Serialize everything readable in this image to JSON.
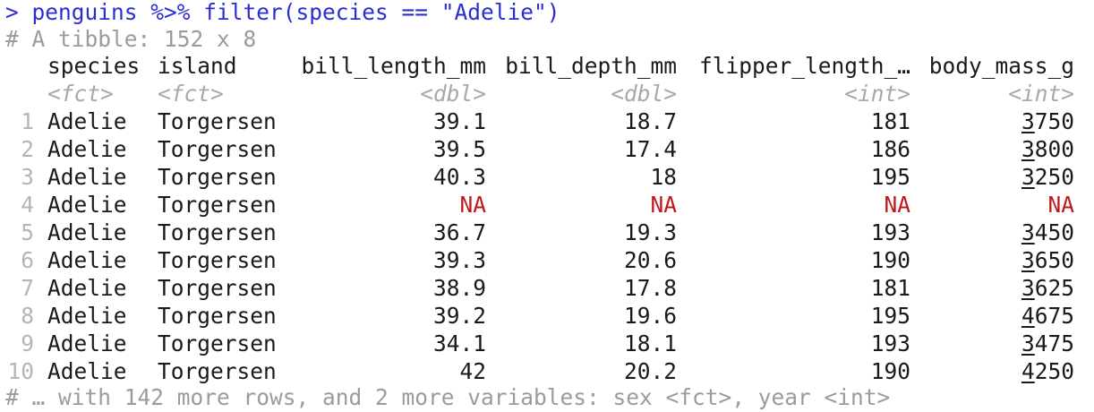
{
  "console": {
    "command": "> penguins %>% filter(species == \"Adelie\")",
    "tibble_info": "# A tibble: 152 x 8",
    "footer": "# … with 142 more rows, and 2 more variables: sex <fct>, year <int>"
  },
  "table": {
    "columns": [
      {
        "name": "species",
        "type": "<fct>"
      },
      {
        "name": "island",
        "type": "<fct>"
      },
      {
        "name": "bill_length_mm",
        "type": "<dbl>"
      },
      {
        "name": "bill_depth_mm",
        "type": "<dbl>"
      },
      {
        "name": "flipper_length_…",
        "type": "<int>"
      },
      {
        "name": "body_mass_g",
        "type": "<int>"
      }
    ],
    "rows": [
      {
        "n": "1",
        "species": "Adelie",
        "island": "Torgersen",
        "bill_length_mm": "39.1",
        "bill_depth_mm": "18.7",
        "flipper_length": "181",
        "body_mass_g": "3750"
      },
      {
        "n": "2",
        "species": "Adelie",
        "island": "Torgersen",
        "bill_length_mm": "39.5",
        "bill_depth_mm": "17.4",
        "flipper_length": "186",
        "body_mass_g": "3800"
      },
      {
        "n": "3",
        "species": "Adelie",
        "island": "Torgersen",
        "bill_length_mm": "40.3",
        "bill_depth_mm": "18",
        "flipper_length": "195",
        "body_mass_g": "3250"
      },
      {
        "n": "4",
        "species": "Adelie",
        "island": "Torgersen",
        "bill_length_mm": "NA",
        "bill_depth_mm": "NA",
        "flipper_length": "NA",
        "body_mass_g": "NA"
      },
      {
        "n": "5",
        "species": "Adelie",
        "island": "Torgersen",
        "bill_length_mm": "36.7",
        "bill_depth_mm": "19.3",
        "flipper_length": "193",
        "body_mass_g": "3450"
      },
      {
        "n": "6",
        "species": "Adelie",
        "island": "Torgersen",
        "bill_length_mm": "39.3",
        "bill_depth_mm": "20.6",
        "flipper_length": "190",
        "body_mass_g": "3650"
      },
      {
        "n": "7",
        "species": "Adelie",
        "island": "Torgersen",
        "bill_length_mm": "38.9",
        "bill_depth_mm": "17.8",
        "flipper_length": "181",
        "body_mass_g": "3625"
      },
      {
        "n": "8",
        "species": "Adelie",
        "island": "Torgersen",
        "bill_length_mm": "39.2",
        "bill_depth_mm": "19.6",
        "flipper_length": "195",
        "body_mass_g": "4675"
      },
      {
        "n": "9",
        "species": "Adelie",
        "island": "Torgersen",
        "bill_length_mm": "34.1",
        "bill_depth_mm": "18.1",
        "flipper_length": "193",
        "body_mass_g": "3475"
      },
      {
        "n": "10",
        "species": "Adelie",
        "island": "Torgersen",
        "bill_length_mm": "42",
        "bill_depth_mm": "20.2",
        "flipper_length": "190",
        "body_mass_g": "4250"
      }
    ]
  },
  "colors": {
    "command": "#2a2ecf",
    "comment": "#9b9b9b",
    "na": "#c0171d",
    "text": "#1a1a1a"
  }
}
